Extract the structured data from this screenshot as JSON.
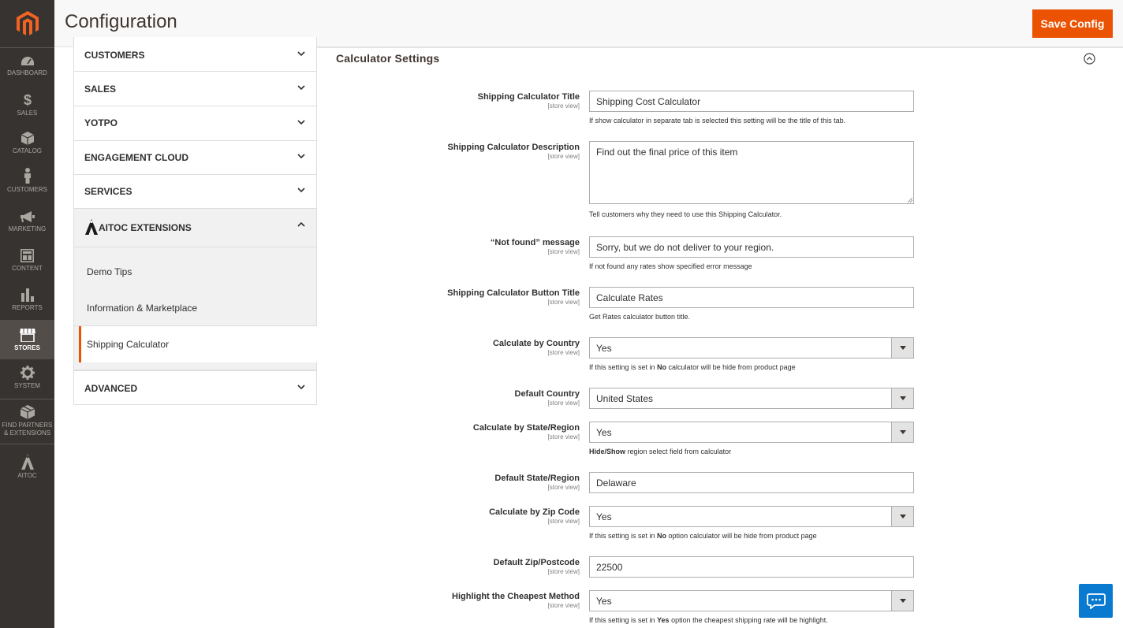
{
  "header": {
    "title": "Configuration",
    "save_label": "Save Config"
  },
  "admin_menu": [
    {
      "label": "DASHBOARD",
      "icon": "dashboard-icon"
    },
    {
      "label": "SALES",
      "icon": "dollar-icon"
    },
    {
      "label": "CATALOG",
      "icon": "box-icon"
    },
    {
      "label": "CUSTOMERS",
      "icon": "person-icon"
    },
    {
      "label": "MARKETING",
      "icon": "megaphone-icon"
    },
    {
      "label": "CONTENT",
      "icon": "layout-icon"
    },
    {
      "label": "REPORTS",
      "icon": "bar-chart-icon"
    },
    {
      "label": "STORES",
      "icon": "store-icon"
    },
    {
      "label": "SYSTEM",
      "icon": "gear-icon"
    },
    {
      "label": "FIND PARTNERS & EXTENSIONS",
      "icon": "cube-icon"
    },
    {
      "label": "AITOC",
      "icon": "aitoc-icon"
    }
  ],
  "tabs": [
    {
      "label": "CUSTOMERS"
    },
    {
      "label": "SALES"
    },
    {
      "label": "YOTPO"
    },
    {
      "label": "ENGAGEMENT CLOUD"
    },
    {
      "label": "SERVICES"
    },
    {
      "label": "AITOC EXTENSIONS"
    },
    {
      "label": "ADVANCED"
    }
  ],
  "aitoc_items": [
    {
      "label": "Demo Tips"
    },
    {
      "label": "Information & Marketplace"
    },
    {
      "label": "Shipping Calculator"
    }
  ],
  "section": {
    "title": "Calculator Settings"
  },
  "fields": [
    {
      "label": "Shipping Calculator Title",
      "scope": "[store view]",
      "value": "Shipping Cost Calculator",
      "note": "If show calculator in separate tab is selected this setting will be the title of this tab."
    },
    {
      "label": "Shipping Calculator Description",
      "scope": "[store view]",
      "value": "Find out the final price of this item",
      "note": "Tell customers why they need to use this Shipping Calculator."
    },
    {
      "label": "“Not found” message",
      "scope": "[store view]",
      "value": "Sorry, but we do not deliver to your region.",
      "note": "If not found any rates show specified error message"
    },
    {
      "label": "Shipping Calculator Button Title",
      "scope": "[store view]",
      "value": "Calculate Rates",
      "note": "Get Rates calculator button title."
    },
    {
      "label": "Calculate by Country",
      "scope": "[store view]",
      "value": "Yes",
      "note_pre": "If this setting is set in ",
      "note_bold": "No",
      "note_post": " calculator will be hide from product page"
    },
    {
      "label": "Default Country",
      "scope": "[store view]",
      "value": "United States"
    },
    {
      "label": "Calculate by State/Region",
      "scope": "[store view]",
      "value": "Yes",
      "note_pre": "",
      "note_bold": "Hide/Show",
      "note_post": " region select field from calculator"
    },
    {
      "label": "Default State/Region",
      "scope": "[store view]",
      "value": "Delaware"
    },
    {
      "label": "Calculate by Zip Code",
      "scope": "[store view]",
      "value": "Yes",
      "note_pre": "If this setting is set in ",
      "note_bold": "No",
      "note_post": " option calculator will be hide from product page"
    },
    {
      "label": "Default Zip/Postcode",
      "scope": "[store view]",
      "value": "22500"
    },
    {
      "label": "Highlight the Cheapest Method",
      "scope": "[store view]",
      "value": "Yes",
      "note_pre": "If this setting is set in ",
      "note_bold": "Yes",
      "note_post": " option the cheapest shipping rate will be highlight."
    }
  ]
}
